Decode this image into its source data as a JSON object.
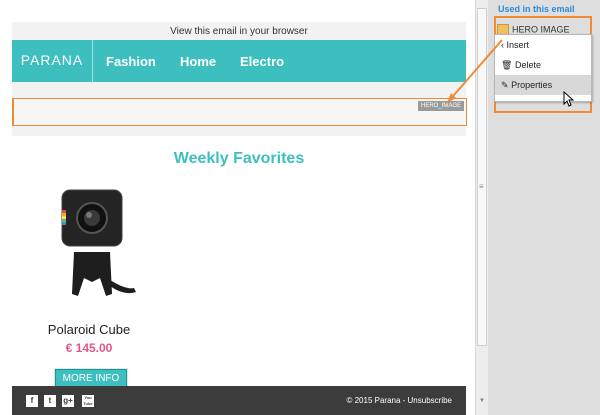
{
  "email": {
    "view_in_browser": "View this email in your browser",
    "logo": "PARANA",
    "nav": [
      "Fashion",
      "Home",
      "Electro"
    ],
    "hero_tag": "HERO_IMAGE",
    "section_title": "Weekly Favorites",
    "product": {
      "name": "Polaroid Cube",
      "price": "€ 145.00",
      "button": "MORE INFO"
    },
    "footer": {
      "social": [
        "f",
        "t",
        "g+",
        "You Tube"
      ],
      "copyright": "© 2015 Parana - Unsubscribe"
    }
  },
  "panel": {
    "title": "Used in this email",
    "block_name": "HERO IMAGE",
    "menu": [
      "Insert",
      "Delete",
      "Properties"
    ],
    "menu_icons": [
      "chevron-left-icon",
      "trash-icon",
      "pencil-icon"
    ]
  },
  "colors": {
    "accent": "#3ebfbf",
    "highlight": "#f08a36",
    "price": "#e0578a",
    "footer": "#3c3c3c"
  }
}
